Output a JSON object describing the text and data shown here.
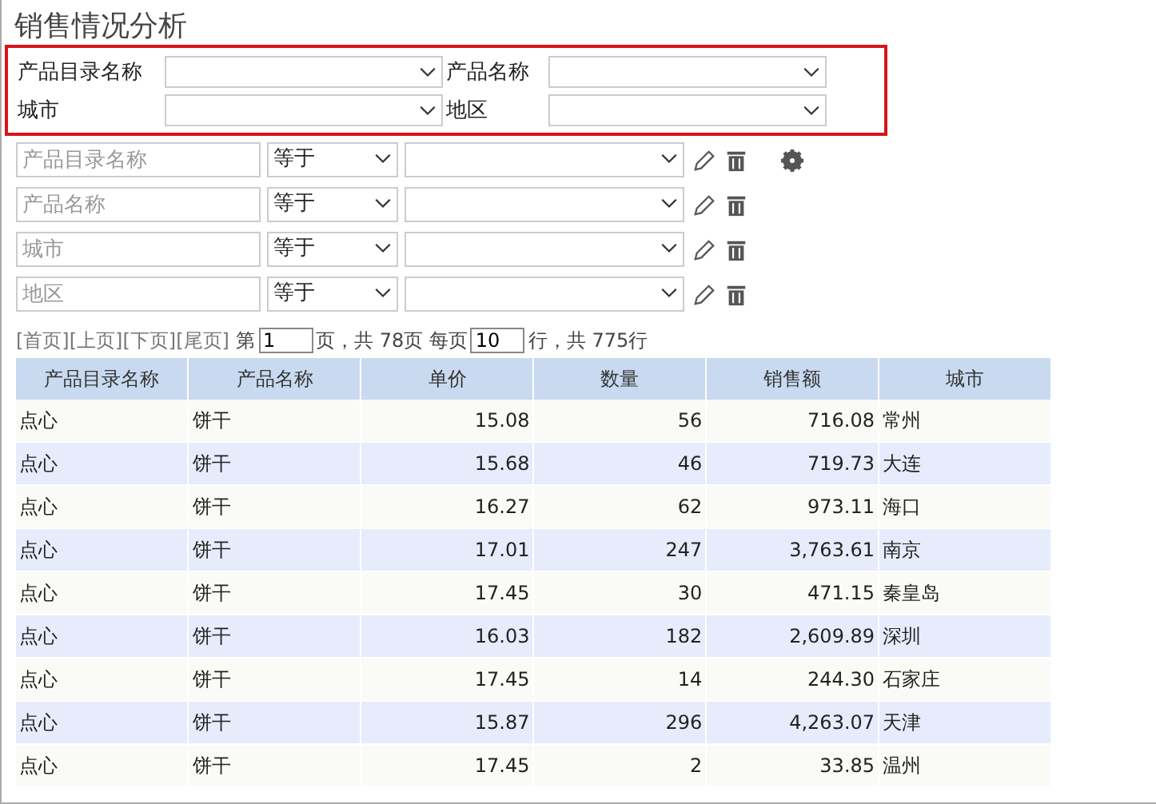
{
  "title": "销售情况分析",
  "params": [
    [
      {
        "label": "产品目录名称"
      },
      {
        "label": "产品名称"
      }
    ],
    [
      {
        "label": "城市"
      },
      {
        "label": "地区"
      }
    ]
  ],
  "filters": [
    {
      "placeholder": "产品目录名称",
      "operator": "等于",
      "settings": true
    },
    {
      "placeholder": "产品名称",
      "operator": "等于",
      "settings": false
    },
    {
      "placeholder": "城市",
      "operator": "等于",
      "settings": false
    },
    {
      "placeholder": "地区",
      "operator": "等于",
      "settings": false
    }
  ],
  "pager": {
    "links": [
      "[首页]",
      "[上页]",
      "[下页]",
      "[尾页]"
    ],
    "page_prefix": "第",
    "page": "1",
    "page_suffix": "页，共 78页 每页",
    "per_page": "10",
    "rows_suffix": "行，共 775行"
  },
  "table": {
    "columns": [
      "产品目录名称",
      "产品名称",
      "单价",
      "数量",
      "销售额",
      "城市"
    ],
    "rows": [
      [
        "点心",
        "饼干",
        "15.08",
        "56",
        "716.08",
        "常州"
      ],
      [
        "点心",
        "饼干",
        "15.68",
        "46",
        "719.73",
        "大连"
      ],
      [
        "点心",
        "饼干",
        "16.27",
        "62",
        "973.11",
        "海口"
      ],
      [
        "点心",
        "饼干",
        "17.01",
        "247",
        "3,763.61",
        "南京"
      ],
      [
        "点心",
        "饼干",
        "17.45",
        "30",
        "471.15",
        "秦皇岛"
      ],
      [
        "点心",
        "饼干",
        "16.03",
        "182",
        "2,609.89",
        "深圳"
      ],
      [
        "点心",
        "饼干",
        "17.45",
        "14",
        "244.30",
        "石家庄"
      ],
      [
        "点心",
        "饼干",
        "15.87",
        "296",
        "4,263.07",
        "天津"
      ],
      [
        "点心",
        "饼干",
        "17.45",
        "2",
        "33.85",
        "温州"
      ]
    ]
  }
}
